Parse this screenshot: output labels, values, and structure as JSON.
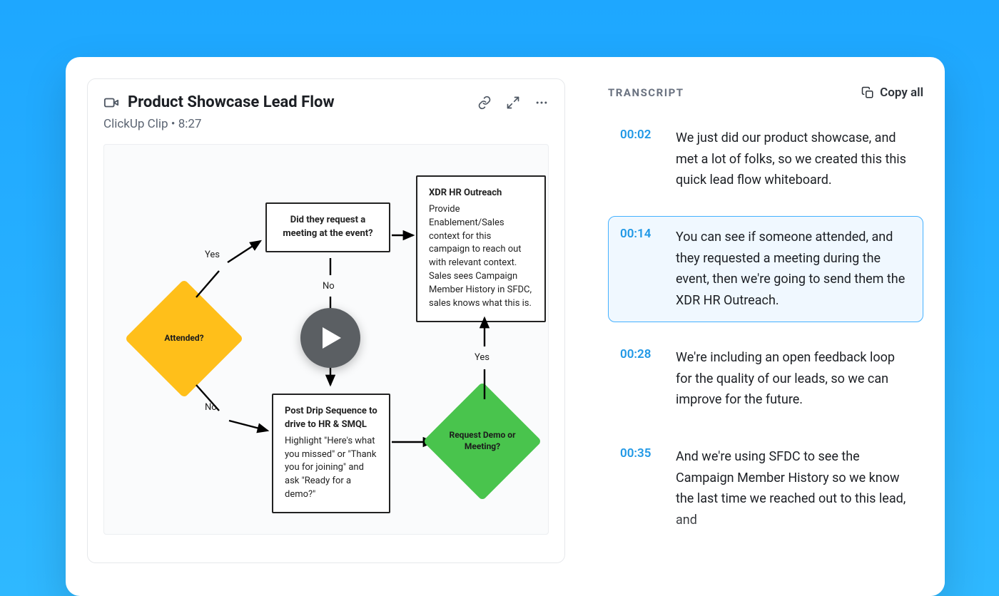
{
  "clip": {
    "title": "Product Showcase Lead Flow",
    "source_label": "ClickUp Clip",
    "separator": " • ",
    "duration": "8:27"
  },
  "diagram": {
    "attended_label": "Attended?",
    "yes_1": "Yes",
    "no_1": "No",
    "request_meeting_label": "Did they request a meeting at the event?",
    "no_2": "No",
    "xdr_title": "XDR HR Outreach",
    "xdr_body": "Provide Enablement/Sales context for this campaign to reach out with relevant context. Sales sees Campaign Member History in SFDC, sales knows what this is.",
    "post_drip_title": "Post Drip Sequence to drive to HR & SMQL",
    "post_drip_body": "Highlight \"Here's what you missed\" or \"Thank you for joining\" and ask \"Ready for a demo?\"",
    "request_demo_label": "Request Demo or Meeting?",
    "yes_2": "Yes"
  },
  "transcript": {
    "header": "TRANSCRIPT",
    "copy_all": "Copy all",
    "entries": [
      {
        "time": "00:02",
        "text": "We just did our product showcase, and met a lot of folks, so we created this this quick lead flow whiteboard."
      },
      {
        "time": "00:14",
        "text": "You can see if someone attended, and they requested a meeting during the event, then we're going to send them the XDR HR Outreach.",
        "active": true
      },
      {
        "time": "00:28",
        "text": "We're including an open feedback loop for the quality of our leads, so we can improve for the future."
      },
      {
        "time": "00:35",
        "text": "And we're using SFDC to see the Campaign Member History so we know the last time we reached out to this lead, and"
      }
    ]
  }
}
